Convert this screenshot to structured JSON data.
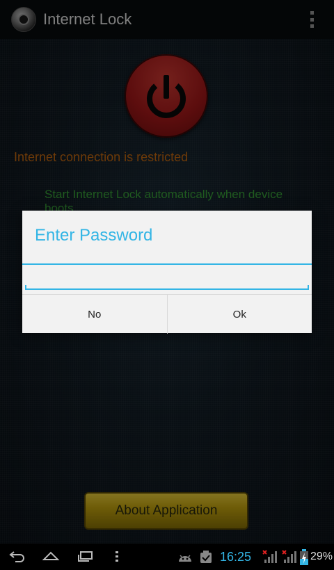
{
  "action_bar": {
    "title": "Internet Lock",
    "icon": "app-lock-icon",
    "overflow_icon": "overflow-menu-icon"
  },
  "main": {
    "power_icon": "power-icon",
    "status_text": "Internet connection is restricted",
    "autostart_text": "Start Internet Lock automatically when device boots",
    "about_button_label": "About Application",
    "colors": {
      "status": "#c86a10",
      "autostart": "#3aa53a",
      "power": "#a8191a",
      "about_button": "#d9b920"
    }
  },
  "dialog": {
    "title": "Enter Password",
    "password_value": "",
    "no_label": "No",
    "ok_label": "Ok",
    "accent_color": "#33b5e5"
  },
  "system_bar": {
    "back_icon": "back-icon",
    "home_icon": "home-icon",
    "recents_icon": "recent-apps-icon",
    "menu_icon": "menu-icon",
    "notification_icons": [
      "android-debug-icon",
      "task-check-icon"
    ],
    "time": "16:25",
    "signal_icons": [
      "signal-no-service-icon",
      "signal-no-service-icon"
    ],
    "battery_icon": "battery-charging-icon",
    "battery_percent": "29%"
  }
}
